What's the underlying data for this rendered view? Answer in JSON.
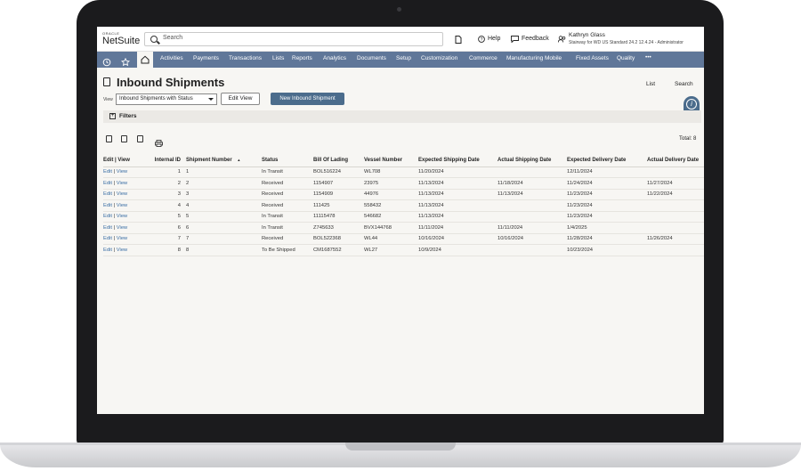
{
  "app": {
    "logo_small": "ORACLE",
    "logo_big": "NetSuite",
    "search_placeholder": "Search",
    "help_label": "Help",
    "feedback_label": "Feedback",
    "user_name": "Kathryn Glass",
    "user_role": "Stairway for WD US Standard 24.2 12.4.24 - Administrator"
  },
  "nav": {
    "items": [
      "Activities",
      "Payments",
      "Transactions",
      "Lists",
      "Reports",
      "Analytics",
      "Documents",
      "Setup",
      "Customization",
      "Commerce",
      "Manufacturing Mobile",
      "Fixed Assets",
      "Quality"
    ],
    "more": "•••"
  },
  "page": {
    "title": "Inbound Shipments",
    "list_link": "List",
    "search_link": "Search",
    "view_label": "View",
    "view_selected": "Inbound Shipments with Status",
    "edit_view_button": "Edit View",
    "new_button": "New Inbound Shipment",
    "filters_label": "Filters",
    "total": "Total: 8"
  },
  "table": {
    "headers": {
      "edit_view": "Edit | View",
      "internal_id": "Internal ID",
      "shipment_number": "Shipment Number",
      "sort_indicator": "▲",
      "status": "Status",
      "bill_of_lading": "Bill Of Lading",
      "vessel_number": "Vessel Number",
      "expected_shipping": "Expected Shipping Date",
      "actual_shipping": "Actual Shipping Date",
      "expected_delivery": "Expected Delivery Date",
      "actual_delivery": "Actual Delivery Date"
    },
    "edit": "Edit",
    "view": "View",
    "separator": "|",
    "rows": [
      {
        "id": "1",
        "num": "1",
        "status": "In Transit",
        "bol": "BOL516224",
        "vessel": "WL708",
        "exp_ship": "11/20/2024",
        "act_ship": "",
        "exp_del": "12/11/2024",
        "act_del": ""
      },
      {
        "id": "2",
        "num": "2",
        "status": "Received",
        "bol": "1154907",
        "vessel": "23975",
        "exp_ship": "11/13/2024",
        "act_ship": "11/18/2024",
        "exp_del": "11/24/2024",
        "act_del": "11/27/2024"
      },
      {
        "id": "3",
        "num": "3",
        "status": "Received",
        "bol": "1154909",
        "vessel": "44976",
        "exp_ship": "11/13/2024",
        "act_ship": "11/13/2024",
        "exp_del": "11/23/2024",
        "act_del": "11/22/2024"
      },
      {
        "id": "4",
        "num": "4",
        "status": "Received",
        "bol": "111425",
        "vessel": "558432",
        "exp_ship": "11/13/2024",
        "act_ship": "",
        "exp_del": "11/23/2024",
        "act_del": ""
      },
      {
        "id": "5",
        "num": "5",
        "status": "In Transit",
        "bol": "11115478",
        "vessel": "546682",
        "exp_ship": "11/13/2024",
        "act_ship": "",
        "exp_del": "11/23/2024",
        "act_del": ""
      },
      {
        "id": "6",
        "num": "6",
        "status": "In Transit",
        "bol": "Z745633",
        "vessel": "BVX144768",
        "exp_ship": "11/11/2024",
        "act_ship": "11/11/2024",
        "exp_del": "1/4/2025",
        "act_del": ""
      },
      {
        "id": "7",
        "num": "7",
        "status": "Received",
        "bol": "BOL522368",
        "vessel": "WL44",
        "exp_ship": "10/16/2024",
        "act_ship": "10/16/2024",
        "exp_del": "11/28/2024",
        "act_del": "11/26/2024"
      },
      {
        "id": "8",
        "num": "8",
        "status": "To Be Shipped",
        "bol": "CM1687552",
        "vessel": "WL27",
        "exp_ship": "10/9/2024",
        "act_ship": "",
        "exp_del": "10/23/2024",
        "act_del": ""
      }
    ]
  },
  "colors": {
    "nav_bg": "#607799",
    "primary_button": "#4b6c8c",
    "link": "#3a6ea5"
  }
}
